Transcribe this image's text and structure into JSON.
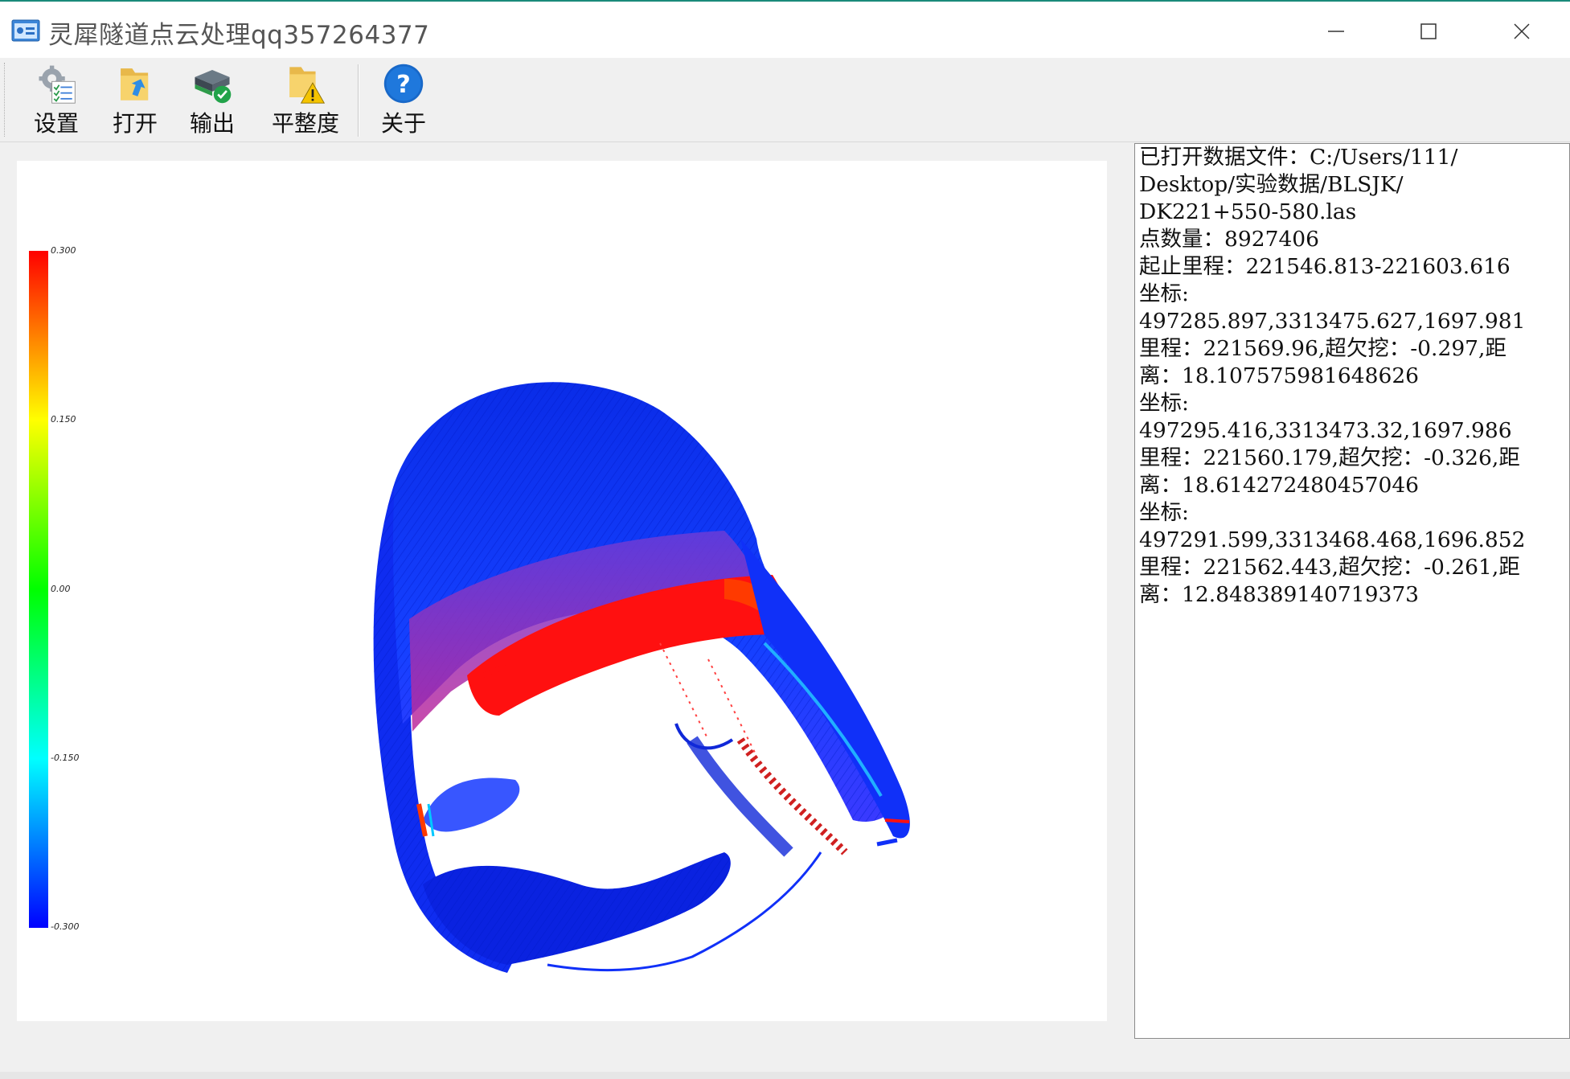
{
  "window": {
    "title": "灵犀隧道点云处理qq357264377",
    "app_icon": "app-window-icon",
    "controls": [
      "minimize-icon",
      "maximize-icon",
      "close-icon"
    ]
  },
  "toolbar": {
    "items": [
      {
        "label": "设置",
        "icon": "settings-icon"
      },
      {
        "label": "打开",
        "icon": "open-folder-icon"
      },
      {
        "label": "输出",
        "icon": "export-icon"
      },
      {
        "label": "平整度",
        "icon": "flatness-warning-icon"
      },
      {
        "label": "关于",
        "icon": "help-icon"
      }
    ]
  },
  "colorbar": {
    "ticks": [
      "0.300",
      "0.150",
      "0.00",
      "-0.150",
      "-0.300"
    ],
    "colors": [
      "#ff0000",
      "#ffff00",
      "#00ff00",
      "#00ffff",
      "#0000ff"
    ]
  },
  "point_cloud": {
    "dominant_color": "#0033ff",
    "highlight_color": "#ff0000",
    "mid_color": "#a040c0"
  },
  "info_panel": {
    "lines": [
      "已打开数据文件：C:/Users/111/",
      "Desktop/实验数据/BLSJK/",
      "DK221+550-580.las",
      "点数量：8927406",
      "起止里程：221546.813-221603.616",
      "坐标:",
      "497285.897,3313475.627,1697.981",
      "里程：221569.96,超欠挖：-0.297,距",
      "离：18.107575981648626",
      "坐标:",
      "497295.416,3313473.32,1697.986",
      "里程：221560.179,超欠挖：-0.326,距",
      "离：18.614272480457046",
      "坐标:",
      "497291.599,3313468.468,1696.852",
      "里程：221562.443,超欠挖：-0.261,距",
      "离：12.848389140719373"
    ]
  }
}
